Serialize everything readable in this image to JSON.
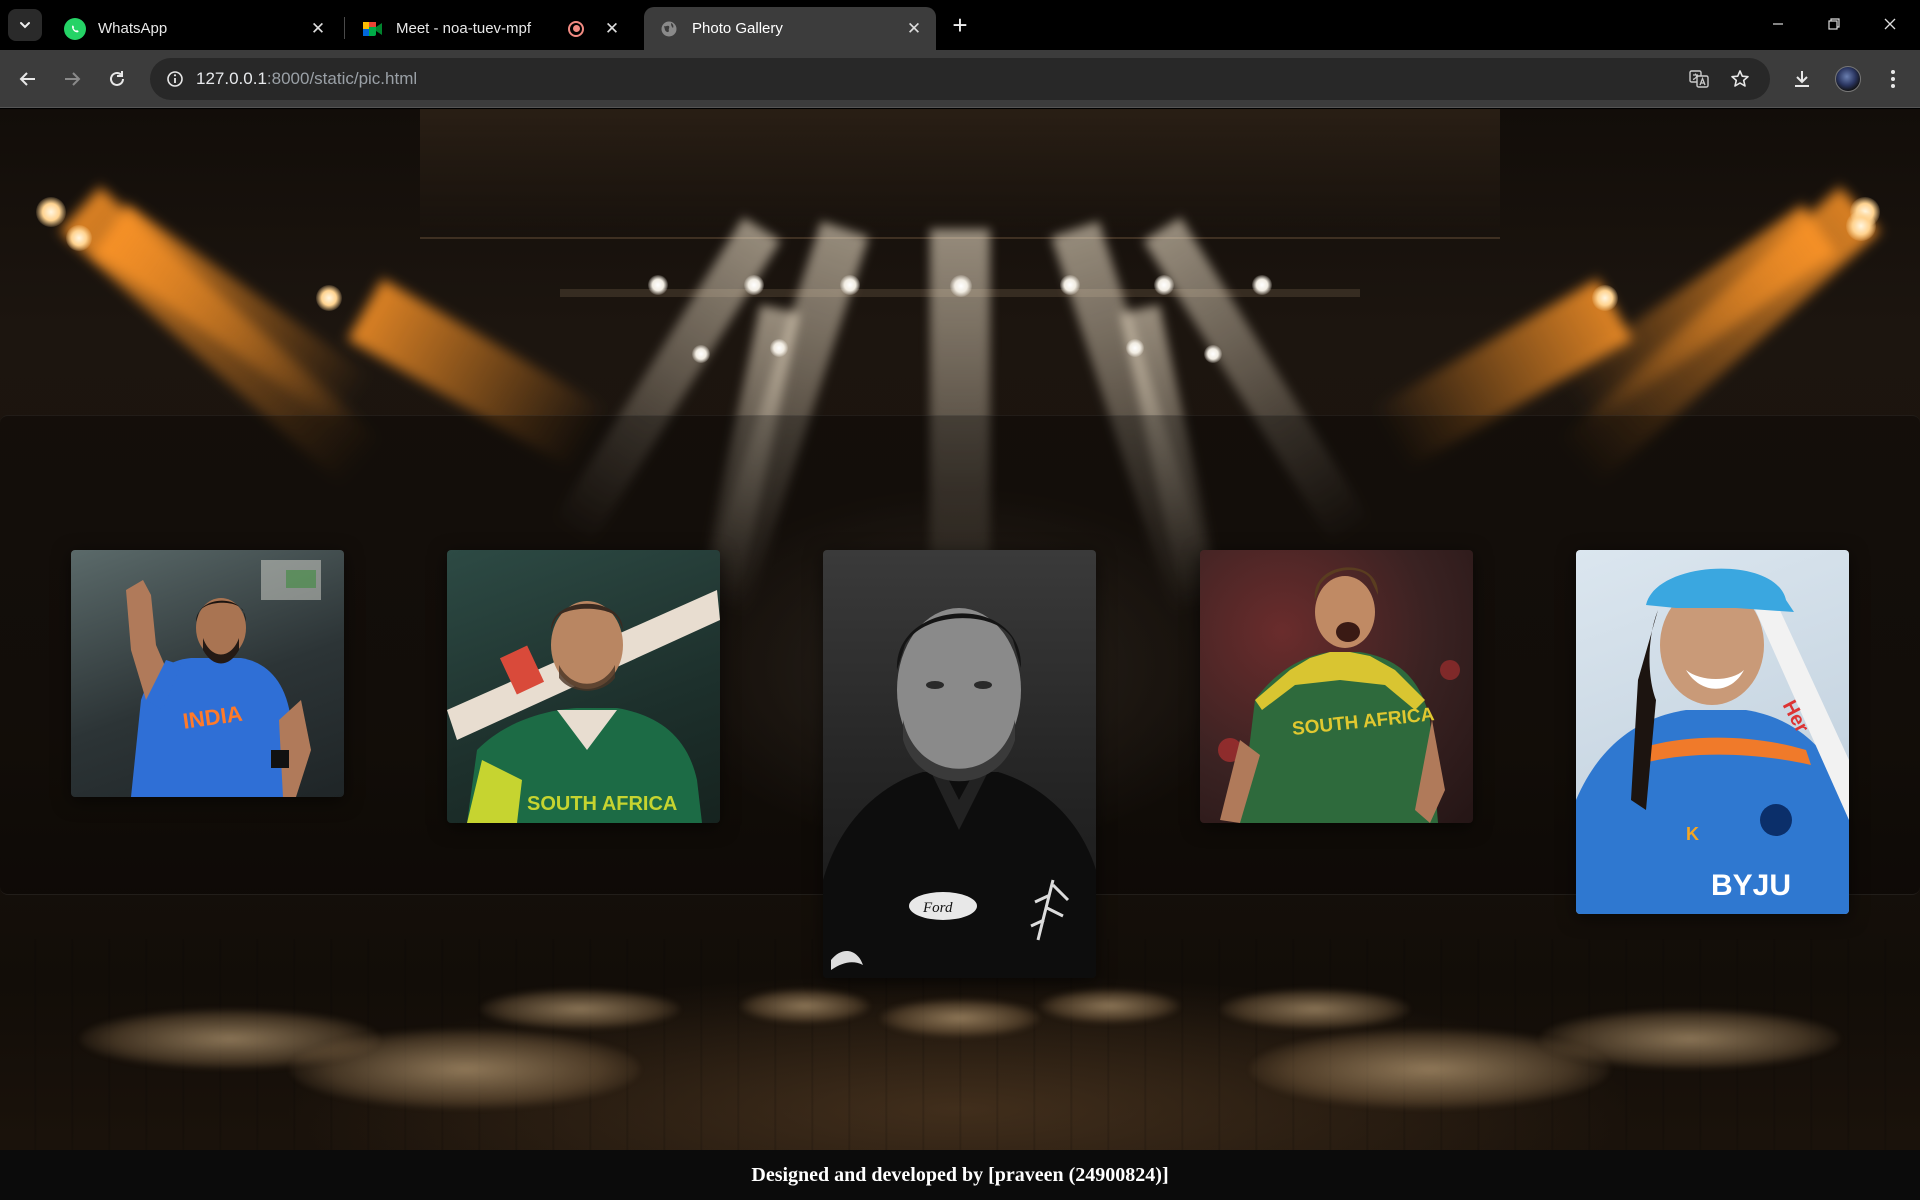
{
  "browser": {
    "tabs": [
      {
        "label": "WhatsApp",
        "icon": "whatsapp-icon"
      },
      {
        "label": "Meet - noa-tuev-mpf",
        "icon": "google-meet-icon",
        "recording": true
      },
      {
        "label": "Photo Gallery",
        "icon": "globe-icon",
        "active": true
      }
    ],
    "url_host": "127.0.0.1",
    "url_rest": ":8000/static/pic.html"
  },
  "gallery": {
    "photos": [
      {
        "alt": "Cricketer in blue India jersey celebrating",
        "palette": [
          "#3b6fd0",
          "#2d2d2d"
        ]
      },
      {
        "alt": "Cricketer in green South Africa jersey holding bat",
        "palette": [
          "#1c5a3c",
          "#243a36"
        ]
      },
      {
        "alt": "Black and white portrait of cricketer",
        "palette": [
          "#1a1a1a",
          "#3a3a3a"
        ]
      },
      {
        "alt": "Fast bowler in South Africa jersey shouting",
        "palette": [
          "#2f5a3a",
          "#5a2a2a"
        ]
      },
      {
        "alt": "Smiling cricketer in blue India jersey with helmet",
        "palette": [
          "#2f74c9",
          "#e9f0f6"
        ]
      }
    ]
  },
  "footer": {
    "credit": "Designed and developed by [praveen (24900824)]"
  }
}
